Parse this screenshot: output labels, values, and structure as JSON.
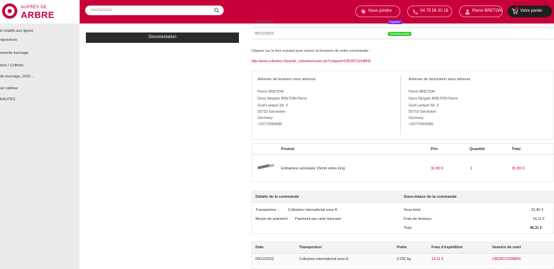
{
  "brand": {
    "small": "AUPRÈS  DE",
    "big": "ARBRE"
  },
  "search": {
    "placeholder": "Rechercher"
  },
  "header": {
    "buttons": [
      {
        "label": "Nous joindre"
      },
      {
        "label": "04 75 56 20 19"
      },
      {
        "label": "Pierre BRETON"
      }
    ],
    "cart_label": "Votre panier"
  },
  "sidebar": {
    "items": [
      {
        "label": "ls relatifs aux lignes"
      },
      {
        "label": "ograveurs"
      },
      {
        "label": "ements tournage"
      },
      {
        "label": "ions / Coffrets"
      },
      {
        "label": "de tournage, DVD..."
      },
      {
        "label": "ue cadeau"
      },
      {
        "label": "EAUTÉS"
      }
    ]
  },
  "doc_button": "Documentation",
  "status": {
    "rows": [
      {
        "date": "09/12/2022",
        "badge": "Expédiée",
        "badge_color": "#8a2be2"
      },
      {
        "date": "09/12/2022",
        "badge": "Paiement accepté",
        "badge_color": "#32cd32"
      }
    ]
  },
  "notice": "Cliquez sur le lien suivant pour suivre la livraison de votre commande :",
  "tracking_url": "http://www.colissimo.fr/portail_colissimo/suivre.do?colispart=CB028712948FR",
  "delivery_address": {
    "title": "Adresse de livraison sans adresse",
    "lines": [
      "Pierre BRETON",
      "Deco Neujahr BRETON Pierre",
      "Graf-Lampel-Str. 3",
      "55710 Gerolstein",
      "Germany",
      "+33770004680"
    ]
  },
  "billing_address": {
    "title": "Adresse de facturation sans adresse",
    "lines": [
      "Pierre BRETON",
      "Deco Neujahr BRETON Pierre",
      "Graf-Lampel-Str. 3",
      "55710 Gerolstein",
      "Germany",
      "+33770004680"
    ]
  },
  "products": {
    "headers": {
      "product": "Produit",
      "price": "Prix",
      "qty": "Quantité",
      "total": "Total"
    },
    "rows": [
      {
        "name": "Entraineur annulaire 15mm extra long",
        "price": "31,80 €",
        "qty": "1",
        "total": "31,80 €"
      }
    ]
  },
  "details": {
    "title_left": "Détails de la commande",
    "title_right": "Sous-totaux de la commande",
    "left": [
      {
        "label": "Transporteur :",
        "value": "Colissimo international zone A"
      },
      {
        "label": "Moyen de paiement :",
        "value": "Paiement par carte bancaire"
      }
    ],
    "right": [
      {
        "label": "Sous-total",
        "value": "31,80 €"
      },
      {
        "label": "Frais de livraison",
        "value": "14,11 €"
      },
      {
        "label": "Total",
        "value": "46,31 €"
      }
    ]
  },
  "shipping": {
    "headers": {
      "date": "Date",
      "carrier": "Transporteur",
      "weight": "Poids",
      "fee": "Frais d'expédition",
      "tracking": "Numéro de suivi"
    },
    "rows": [
      {
        "date": "09/12/2022",
        "carrier": "Colissimo international zone A",
        "weight": "0.250 kg",
        "fee": "14,11 €",
        "tracking": "CB028712948FR"
      }
    ]
  }
}
